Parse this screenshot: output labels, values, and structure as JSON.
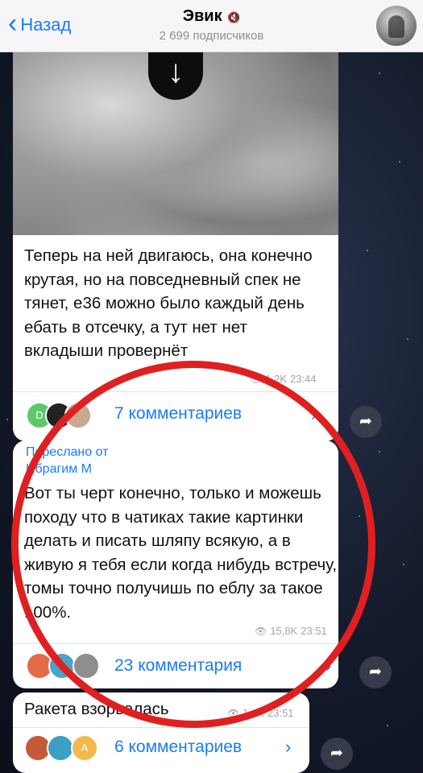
{
  "header": {
    "back_label": "Назад",
    "title": "Эвик",
    "subscribers": "2 699 подписчиков",
    "icons": {
      "back": "chevron-left-icon",
      "mute": "mute-icon"
    }
  },
  "messages": [
    {
      "text": "Теперь на ней двигаюсь, она конечно крутая, но на повседневный спек не тянет, е36 можно было каждый день ебать в отсечку, а тут нет нет вкладыши провернёт",
      "views": "1,2K",
      "time": "23:44",
      "comments_label": "7 комментариев",
      "avatar_letter": "D"
    },
    {
      "forwarded_label": "Переслано от",
      "forwarded_from": "Ибрагим М",
      "text": "Вот ты черт конечно, только и можешь походу что в чатиках такие картинки делать и писать шляпу всякую, а в живую я тебя если когда нибудь встречу, томы точно получишь по еблу за такое 100%.",
      "views": "15,8K",
      "time": "23:51",
      "comments_label": "23 комментария"
    },
    {
      "text": "Ракета взорвалась",
      "views": "1,1K",
      "time": "23:51",
      "comments_label": "6 комментариев",
      "avatar_letter": "A"
    }
  ],
  "colors": {
    "accent": "#1a7cf5",
    "annotation": "#e02020"
  }
}
